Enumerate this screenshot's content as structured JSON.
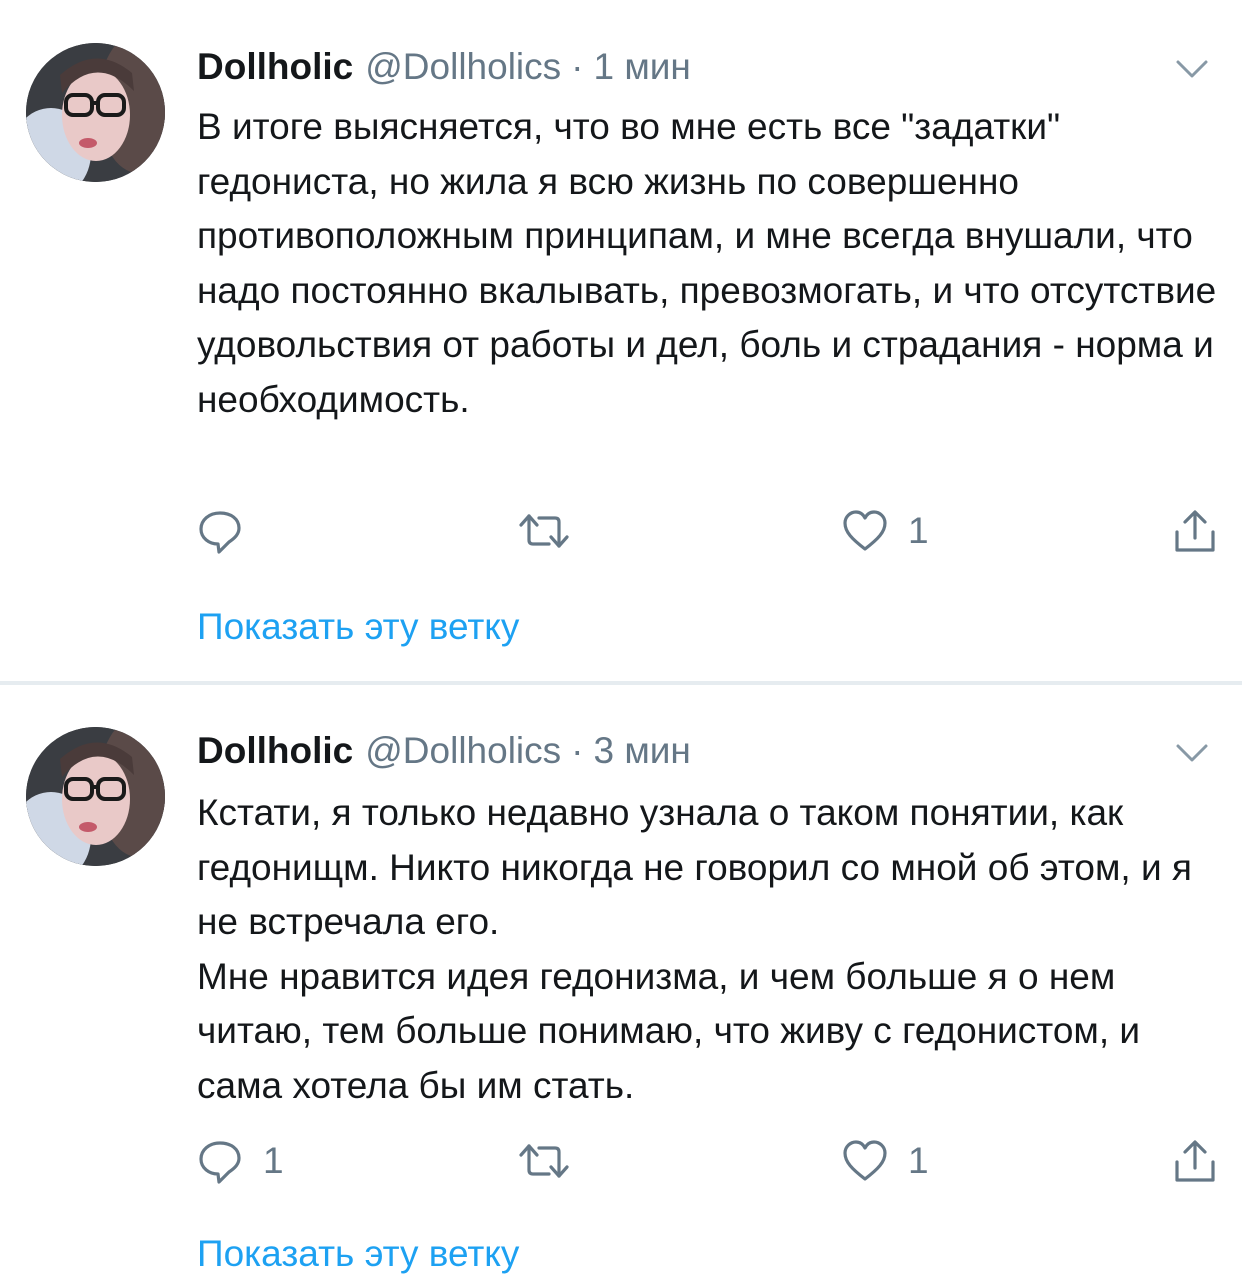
{
  "colors": {
    "accent": "#1da1f2",
    "secondary_text": "#657786",
    "primary_text": "#14171a",
    "divider": "#e6ecf0"
  },
  "icons": {
    "reply": "speech-bubble-outline",
    "retweet": "two-arrows-loop",
    "like": "heart-outline",
    "share": "upload-arrow",
    "menu": "chevron-down"
  },
  "tweets": [
    {
      "display_name": "Dollholic",
      "handle": "@Dollholics",
      "separator": "·",
      "time": "1 мин",
      "text": "В итоге выясняется, что во мне есть все \"задатки\" гедониста, но жила я всю жизнь по совершенно противоположным принципам, и мне всегда внушали, что надо постоянно вкалывать, превозмогать, и что отсутствие удовольствия от работы и дел,  боль и страдания - норма и необходимость.",
      "reply_count": "",
      "retweet_count": "",
      "like_count": "1",
      "show_thread": "Показать эту ветку"
    },
    {
      "display_name": "Dollholic",
      "handle": "@Dollholics",
      "separator": "·",
      "time": "3 мин",
      "text": "Кстати, я только недавно узнала о таком понятии, как гедонищм. Никто никогда не говорил со мной об этом, и я не встречала его.\nМне нравится идея гедонизма, и чем больше я о нем читаю, тем больше понимаю, что живу с гедонистом, и сама хотела бы им стать.",
      "reply_count": "1",
      "retweet_count": "",
      "like_count": "1",
      "show_thread": "Показать эту ветку"
    }
  ]
}
